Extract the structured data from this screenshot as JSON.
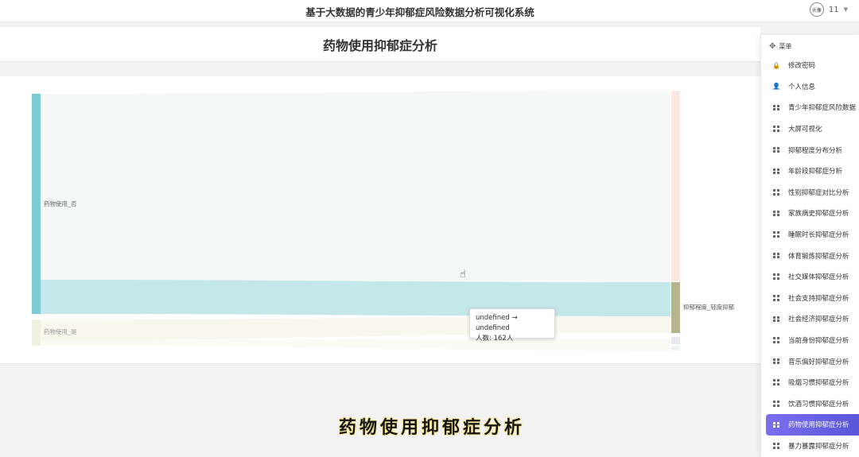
{
  "header": {
    "title": "基于大数据的青少年抑郁症风险数据分析可视化系统",
    "user_label": "11",
    "avatar_text": "头像"
  },
  "page": {
    "title": "药物使用抑郁症分析"
  },
  "sidebar": {
    "menu_label": "菜单",
    "items": [
      {
        "label": "修改密码",
        "icon": "lock-icon",
        "active": false
      },
      {
        "label": "个人信息",
        "icon": "user-icon",
        "active": false
      },
      {
        "label": "青少年抑郁症风险数据",
        "icon": "grid-icon",
        "active": false
      },
      {
        "label": "大屏可视化",
        "icon": "grid-icon",
        "active": false
      },
      {
        "label": "抑郁程度分布分析",
        "icon": "grid-icon",
        "active": false
      },
      {
        "label": "年龄段抑郁症分析",
        "icon": "grid-icon",
        "active": false
      },
      {
        "label": "性别抑郁症对比分析",
        "icon": "grid-icon",
        "active": false
      },
      {
        "label": "家族病史抑郁症分析",
        "icon": "grid-icon",
        "active": false
      },
      {
        "label": "睡眠时长抑郁症分析",
        "icon": "grid-icon",
        "active": false
      },
      {
        "label": "体育锻炼抑郁症分析",
        "icon": "grid-icon",
        "active": false
      },
      {
        "label": "社交媒体抑郁症分析",
        "icon": "grid-icon",
        "active": false
      },
      {
        "label": "社会支持抑郁症分析",
        "icon": "grid-icon",
        "active": false
      },
      {
        "label": "社会经济抑郁症分析",
        "icon": "grid-icon",
        "active": false
      },
      {
        "label": "当前身份抑郁症分析",
        "icon": "grid-icon",
        "active": false
      },
      {
        "label": "音乐偏好抑郁症分析",
        "icon": "grid-icon",
        "active": false
      },
      {
        "label": "吸烟习惯抑郁症分析",
        "icon": "grid-icon",
        "active": false
      },
      {
        "label": "饮酒习惯抑郁症分析",
        "icon": "grid-icon",
        "active": false
      },
      {
        "label": "药物使用抑郁症分析",
        "icon": "grid-icon",
        "active": true
      },
      {
        "label": "暴力暴露抑郁症分析",
        "icon": "grid-icon",
        "active": false
      }
    ]
  },
  "tooltip": {
    "line1": "undefined → undefined",
    "line2": "人数: 162人"
  },
  "subtitle": "药物使用抑郁症分析",
  "colors": {
    "accent": "#6c63e6",
    "node_no": "#7ecbd3",
    "node_yes": "#f1f1e2",
    "target_mild": "#b5b48e",
    "target_severe": "#fbe8e2"
  },
  "chart_data": {
    "type": "sankey",
    "nodes": [
      {
        "name": "药物使用_否",
        "side": "source"
      },
      {
        "name": "药物使用_是",
        "side": "source"
      },
      {
        "name": "抑郁程度_轻度抑郁",
        "side": "target"
      }
    ],
    "links": [
      {
        "source": "药物使用_否",
        "target": "抑郁程度_轻度抑郁",
        "value": 162
      }
    ]
  }
}
